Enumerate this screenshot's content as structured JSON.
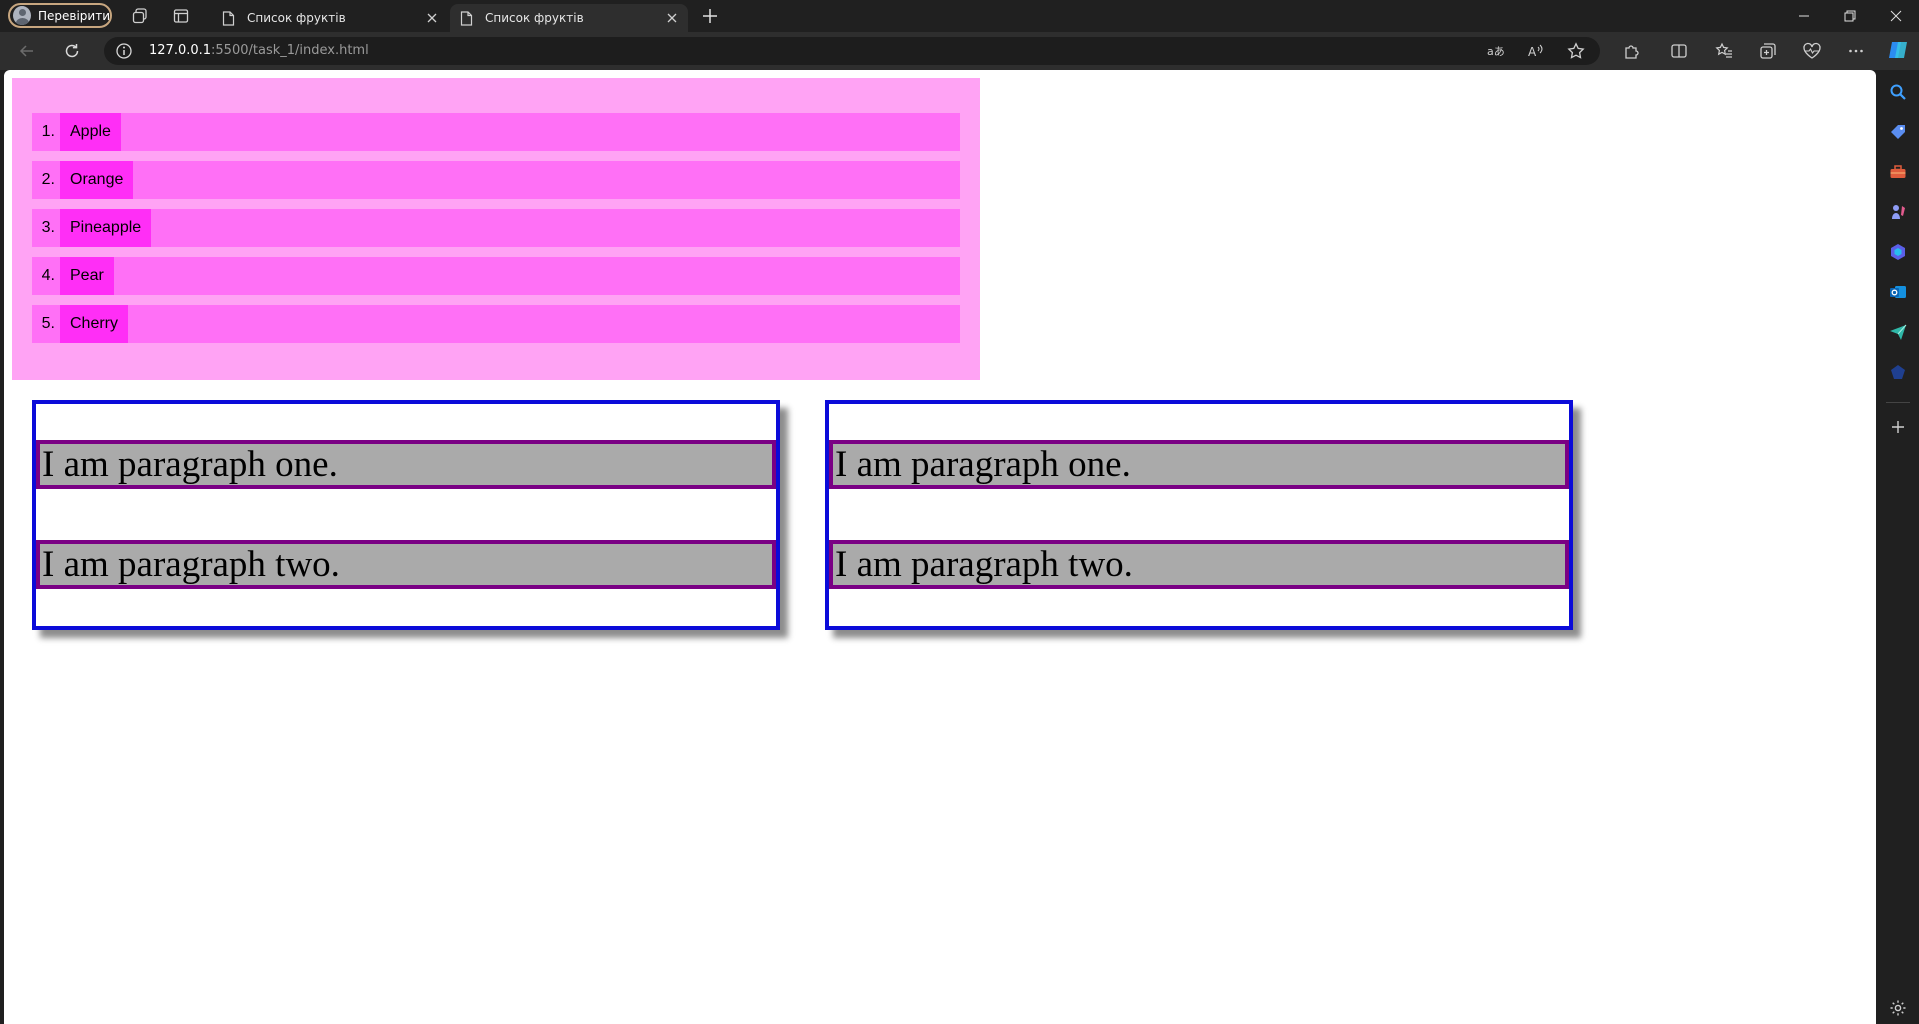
{
  "browser": {
    "profile_label": "Перевірити",
    "tabs": [
      {
        "title": "Список фруктів"
      },
      {
        "title": "Список фруктів"
      }
    ],
    "url": {
      "host": "127.0.0.1",
      "path": ":5500/task_1/index.html"
    }
  },
  "page": {
    "fruits": [
      {
        "number": "1.",
        "name": "Apple"
      },
      {
        "number": "2.",
        "name": "Orange"
      },
      {
        "number": "3.",
        "name": "Pineapple"
      },
      {
        "number": "4.",
        "name": "Pear"
      },
      {
        "number": "5.",
        "name": "Cherry"
      }
    ],
    "boxes": [
      {
        "para_one": "I am paragraph one.",
        "para_two": "I am paragraph two."
      },
      {
        "para_one": "I am paragraph one.",
        "para_two": "I am paragraph two."
      }
    ]
  },
  "colors": {
    "fruit_box_bg": "#ffa3f4",
    "fruit_item_bg": "#ff70f6",
    "fruit_name_bg": "#ff2ef6",
    "box_border": "#0b0bd9",
    "para_border": "#7a0084",
    "para_bg": "#aaaaaa"
  }
}
